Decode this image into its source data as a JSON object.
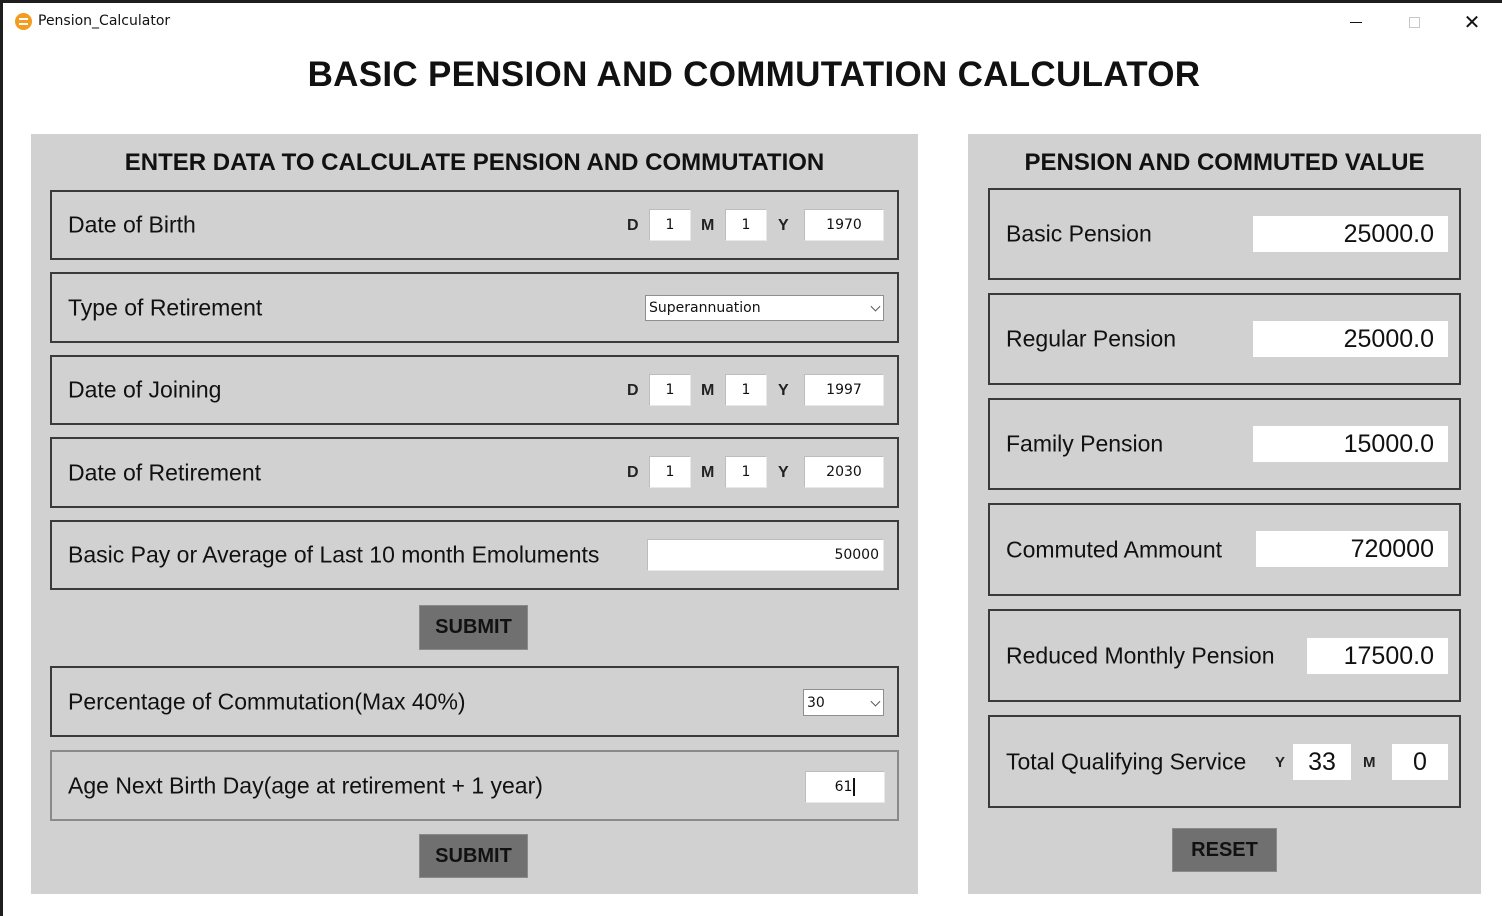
{
  "window": {
    "title": "Pension_Calculator",
    "icon": "app-icon",
    "controls": {
      "minimize": "minimize-icon",
      "maximize": "maximize-icon",
      "close": "close-icon"
    }
  },
  "main_title": "BASIC PENSION AND COMMUTATION CALCULATOR",
  "input_panel": {
    "heading": "ENTER DATA TO CALCULATE PENSION AND COMMUTATION",
    "date_labels": {
      "day": "D",
      "month": "M",
      "year": "Y"
    },
    "date_of_birth": {
      "label": "Date of Birth",
      "day": "1",
      "month": "1",
      "year": "1970"
    },
    "type_of_retirement": {
      "label": "Type of Retirement",
      "selected": "Superannuation"
    },
    "date_of_joining": {
      "label": "Date of Joining",
      "day": "1",
      "month": "1",
      "year": "1997"
    },
    "date_of_retirement": {
      "label": "Date of Retirement",
      "day": "1",
      "month": "1",
      "year": "2030"
    },
    "basic_pay": {
      "label": "Basic Pay or Average of Last 10 month Emoluments",
      "value": "50000"
    },
    "submit_1": "SUBMIT",
    "commutation_percentage": {
      "label": "Percentage of Commutation(Max 40%)",
      "selected": "30"
    },
    "age_next_birthday": {
      "label": "Age Next Birth Day(age at retirement + 1 year)",
      "value": "61"
    },
    "submit_2": "SUBMIT"
  },
  "output_panel": {
    "heading": "PENSION AND COMMUTED VALUE",
    "basic_pension": {
      "label": "Basic Pension",
      "value": "25000.0"
    },
    "regular_pension": {
      "label": "Regular Pension",
      "value": "25000.0"
    },
    "family_pension": {
      "label": "Family Pension",
      "value": "15000.0"
    },
    "commuted_amount": {
      "label": "Commuted Ammount",
      "value": "720000"
    },
    "reduced_monthly_pension": {
      "label": "Reduced Monthly Pension",
      "value": "17500.0"
    },
    "total_qualifying_service": {
      "label": "Total Qualifying Service",
      "year_label": "Y",
      "years": "33",
      "month_label": "M",
      "months": "0"
    },
    "reset": "RESET"
  },
  "colors": {
    "panel_bg": "#d1d1d1",
    "button_bg": "#707070",
    "app_icon": "#f39c1f"
  }
}
